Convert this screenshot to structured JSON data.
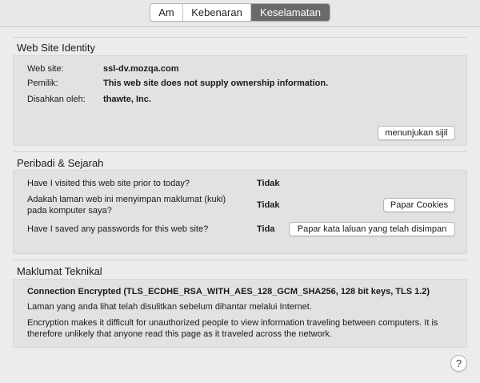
{
  "tabs": [
    {
      "label": "Am",
      "active": false
    },
    {
      "label": "Kebenaran",
      "active": false
    },
    {
      "label": "Keselamatan",
      "active": true
    }
  ],
  "identity": {
    "title": "Web Site Identity",
    "website_label": "Web site:",
    "website_value": "ssl-dv.mozqa.com",
    "owner_label": "Pemilik:",
    "owner_value": "This web site does not supply ownership information.",
    "verified_label": "Disahkan oleh:",
    "verified_value": "thawte, Inc.",
    "view_cert_button": "menunjukan sijil"
  },
  "privacy": {
    "title": "Peribadi & Sejarah",
    "q1": "Have I visited this web site prior to today?",
    "a1": "Tidak",
    "q2_line1": "Adakah laman web ini menyimpan maklumat (kuki)",
    "q2_line2": "pada komputer saya?",
    "a2": "Tidak",
    "cookies_button": "Papar Cookies",
    "q3": "Have I saved any passwords for this web site?",
    "a3": "Tida",
    "passwords_button": "Papar kata laluan yang telah disimpan"
  },
  "technical": {
    "title": "Maklumat Teknikal",
    "connection": "Connection Encrypted (TLS_ECDHE_RSA_WITH_AES_128_GCM_SHA256, 128 bit keys, TLS 1.2)",
    "line1": "Laman yang anda lihat telah disulitkan sebelum dihantar melalui Internet.",
    "line2": "Encryption makes it difficult for unauthorized people to view information traveling between computers. It is",
    "line3": "therefore unlikely that anyone read this page as it traveled across the network."
  },
  "help": {
    "label": "?",
    "icon": "question-mark-icon"
  },
  "colors": {
    "active_tab": "#6a6a6a",
    "panel": "#e2e2e2",
    "background": "#ececec"
  }
}
